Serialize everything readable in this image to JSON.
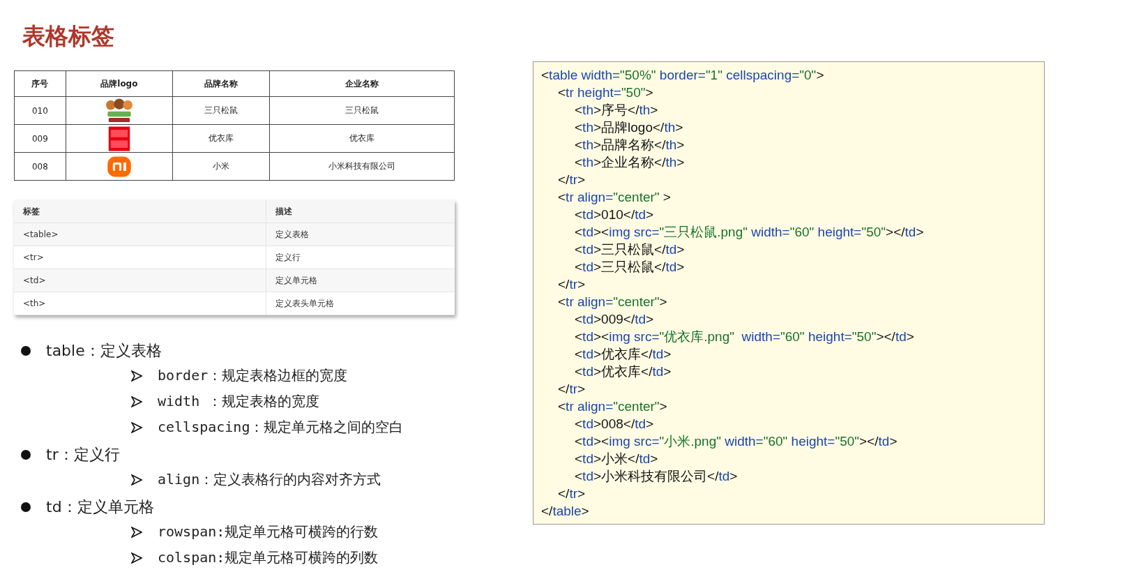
{
  "title": "表格标签",
  "brand_table": {
    "columns": [
      "序号",
      "品牌logo",
      "品牌名称",
      "企业名称"
    ],
    "rows": [
      {
        "number": "010",
        "brand": "三只松鼠",
        "company": "三只松鼠"
      },
      {
        "number": "009",
        "brand": "优衣库",
        "company": "优衣库"
      },
      {
        "number": "008",
        "brand": "小米",
        "company": "小米科技有限公司"
      }
    ]
  },
  "tag_table": {
    "columns": [
      "标签",
      "描述"
    ],
    "rows": [
      {
        "tag": "<table>",
        "description": "定义表格"
      },
      {
        "tag": "<tr>",
        "description": "定义行"
      },
      {
        "tag": "<td>",
        "description": "定义单元格"
      },
      {
        "tag": "<th>",
        "description": "定义表头单元格"
      }
    ]
  },
  "bullets": [
    {
      "text": "table：定义表格",
      "children": [
        {
          "text": "border：规定表格边框的宽度"
        },
        {
          "text": "width ：规定表格的宽度"
        },
        {
          "text": "cellspacing：规定单元格之间的空白"
        }
      ]
    },
    {
      "text": "tr：定义行",
      "children": [
        {
          "text": "align：定义表格行的内容对齐方式"
        }
      ]
    },
    {
      "text": "td：定义单元格",
      "children": [
        {
          "text": "rowspan:规定单元格可横跨的行数"
        },
        {
          "text": "colspan:规定单元格可横跨的列数"
        }
      ]
    }
  ],
  "code": {
    "open": [
      {
        "kind": "punct",
        "text": "<"
      },
      {
        "kind": "tag",
        "text": "table"
      },
      {
        "kind": "attr",
        "text": " width="
      },
      {
        "kind": "string",
        "text": "\"50%\""
      },
      {
        "kind": "attr",
        "text": " border="
      },
      {
        "kind": "string",
        "text": "\"1\""
      },
      {
        "kind": "attr",
        "text": " cellspacing="
      },
      {
        "kind": "string",
        "text": "\"0\""
      },
      {
        "kind": "punct",
        "text": ">"
      }
    ],
    "children": [
      {
        "open": [
          {
            "kind": "punct",
            "text": "<"
          },
          {
            "kind": "tag",
            "text": "tr"
          },
          {
            "kind": "attr",
            "text": " height="
          },
          {
            "kind": "string",
            "text": "\"50\""
          },
          {
            "kind": "punct",
            "text": ">"
          }
        ],
        "children": [
          {
            "line": [
              {
                "kind": "punct",
                "text": "<"
              },
              {
                "kind": "tag",
                "text": "th"
              },
              {
                "kind": "punct",
                "text": ">"
              },
              {
                "kind": "text",
                "text": "序号"
              },
              {
                "kind": "punct",
                "text": "</"
              },
              {
                "kind": "tag",
                "text": "th"
              },
              {
                "kind": "punct",
                "text": ">"
              }
            ]
          },
          {
            "line": [
              {
                "kind": "punct",
                "text": "<"
              },
              {
                "kind": "tag",
                "text": "th"
              },
              {
                "kind": "punct",
                "text": ">"
              },
              {
                "kind": "text",
                "text": "品牌logo"
              },
              {
                "kind": "punct",
                "text": "</"
              },
              {
                "kind": "tag",
                "text": "th"
              },
              {
                "kind": "punct",
                "text": ">"
              }
            ]
          },
          {
            "line": [
              {
                "kind": "punct",
                "text": "<"
              },
              {
                "kind": "tag",
                "text": "th"
              },
              {
                "kind": "punct",
                "text": ">"
              },
              {
                "kind": "text",
                "text": "品牌名称"
              },
              {
                "kind": "punct",
                "text": "</"
              },
              {
                "kind": "tag",
                "text": "th"
              },
              {
                "kind": "punct",
                "text": ">"
              }
            ]
          },
          {
            "line": [
              {
                "kind": "punct",
                "text": "<"
              },
              {
                "kind": "tag",
                "text": "th"
              },
              {
                "kind": "punct",
                "text": ">"
              },
              {
                "kind": "text",
                "text": "企业名称"
              },
              {
                "kind": "punct",
                "text": "</"
              },
              {
                "kind": "tag",
                "text": "th"
              },
              {
                "kind": "punct",
                "text": ">"
              }
            ]
          }
        ],
        "close": [
          {
            "kind": "punct",
            "text": "</"
          },
          {
            "kind": "tag",
            "text": "tr"
          },
          {
            "kind": "punct",
            "text": ">"
          }
        ]
      },
      {
        "open": [
          {
            "kind": "punct",
            "text": "<"
          },
          {
            "kind": "tag",
            "text": "tr"
          },
          {
            "kind": "attr",
            "text": " align="
          },
          {
            "kind": "string",
            "text": "\"center\""
          },
          {
            "kind": "punct",
            "text": " >"
          }
        ],
        "children": [
          {
            "line": [
              {
                "kind": "punct",
                "text": "<"
              },
              {
                "kind": "tag",
                "text": "td"
              },
              {
                "kind": "punct",
                "text": ">"
              },
              {
                "kind": "text",
                "text": "010"
              },
              {
                "kind": "punct",
                "text": "</"
              },
              {
                "kind": "tag",
                "text": "td"
              },
              {
                "kind": "punct",
                "text": ">"
              }
            ]
          },
          {
            "line": [
              {
                "kind": "punct",
                "text": "<"
              },
              {
                "kind": "tag",
                "text": "td"
              },
              {
                "kind": "punct",
                "text": "><"
              },
              {
                "kind": "tag",
                "text": "img"
              },
              {
                "kind": "attr",
                "text": " src="
              },
              {
                "kind": "string",
                "text": "\"三只松鼠.png\""
              },
              {
                "kind": "attr",
                "text": " width="
              },
              {
                "kind": "string",
                "text": "\"60\""
              },
              {
                "kind": "attr",
                "text": " height="
              },
              {
                "kind": "string",
                "text": "\"50\""
              },
              {
                "kind": "punct",
                "text": "></"
              },
              {
                "kind": "tag",
                "text": "td"
              },
              {
                "kind": "punct",
                "text": ">"
              }
            ]
          },
          {
            "line": [
              {
                "kind": "punct",
                "text": "<"
              },
              {
                "kind": "tag",
                "text": "td"
              },
              {
                "kind": "punct",
                "text": ">"
              },
              {
                "kind": "text",
                "text": "三只松鼠"
              },
              {
                "kind": "punct",
                "text": "</"
              },
              {
                "kind": "tag",
                "text": "td"
              },
              {
                "kind": "punct",
                "text": ">"
              }
            ]
          },
          {
            "line": [
              {
                "kind": "punct",
                "text": "<"
              },
              {
                "kind": "tag",
                "text": "td"
              },
              {
                "kind": "punct",
                "text": ">"
              },
              {
                "kind": "text",
                "text": "三只松鼠"
              },
              {
                "kind": "punct",
                "text": "</"
              },
              {
                "kind": "tag",
                "text": "td"
              },
              {
                "kind": "punct",
                "text": ">"
              }
            ]
          }
        ],
        "close": [
          {
            "kind": "punct",
            "text": "</"
          },
          {
            "kind": "tag",
            "text": "tr"
          },
          {
            "kind": "punct",
            "text": ">"
          }
        ]
      },
      {
        "open": [
          {
            "kind": "punct",
            "text": "<"
          },
          {
            "kind": "tag",
            "text": "tr"
          },
          {
            "kind": "attr",
            "text": " align="
          },
          {
            "kind": "string",
            "text": "\"center\""
          },
          {
            "kind": "punct",
            "text": ">"
          }
        ],
        "children": [
          {
            "line": [
              {
                "kind": "punct",
                "text": "<"
              },
              {
                "kind": "tag",
                "text": "td"
              },
              {
                "kind": "punct",
                "text": ">"
              },
              {
                "kind": "text",
                "text": "009"
              },
              {
                "kind": "punct",
                "text": "</"
              },
              {
                "kind": "tag",
                "text": "td"
              },
              {
                "kind": "punct",
                "text": ">"
              }
            ]
          },
          {
            "line": [
              {
                "kind": "punct",
                "text": "<"
              },
              {
                "kind": "tag",
                "text": "td"
              },
              {
                "kind": "punct",
                "text": "><"
              },
              {
                "kind": "tag",
                "text": "img"
              },
              {
                "kind": "attr",
                "text": " src="
              },
              {
                "kind": "string",
                "text": "\"优衣库.png\""
              },
              {
                "kind": "attr",
                "text": "  width="
              },
              {
                "kind": "string",
                "text": "\"60\""
              },
              {
                "kind": "attr",
                "text": " height="
              },
              {
                "kind": "string",
                "text": "\"50\""
              },
              {
                "kind": "punct",
                "text": "></"
              },
              {
                "kind": "tag",
                "text": "td"
              },
              {
                "kind": "punct",
                "text": ">"
              }
            ]
          },
          {
            "line": [
              {
                "kind": "punct",
                "text": "<"
              },
              {
                "kind": "tag",
                "text": "td"
              },
              {
                "kind": "punct",
                "text": ">"
              },
              {
                "kind": "text",
                "text": "优衣库"
              },
              {
                "kind": "punct",
                "text": "</"
              },
              {
                "kind": "tag",
                "text": "td"
              },
              {
                "kind": "punct",
                "text": ">"
              }
            ]
          },
          {
            "line": [
              {
                "kind": "punct",
                "text": "<"
              },
              {
                "kind": "tag",
                "text": "td"
              },
              {
                "kind": "punct",
                "text": ">"
              },
              {
                "kind": "text",
                "text": "优衣库"
              },
              {
                "kind": "punct",
                "text": "</"
              },
              {
                "kind": "tag",
                "text": "td"
              },
              {
                "kind": "punct",
                "text": ">"
              }
            ]
          }
        ],
        "close": [
          {
            "kind": "punct",
            "text": "</"
          },
          {
            "kind": "tag",
            "text": "tr"
          },
          {
            "kind": "punct",
            "text": ">"
          }
        ]
      },
      {
        "open": [
          {
            "kind": "punct",
            "text": "<"
          },
          {
            "kind": "tag",
            "text": "tr"
          },
          {
            "kind": "attr",
            "text": " align="
          },
          {
            "kind": "string",
            "text": "\"center\""
          },
          {
            "kind": "punct",
            "text": ">"
          }
        ],
        "children": [
          {
            "line": [
              {
                "kind": "punct",
                "text": "<"
              },
              {
                "kind": "tag",
                "text": "td"
              },
              {
                "kind": "punct",
                "text": ">"
              },
              {
                "kind": "text",
                "text": "008"
              },
              {
                "kind": "punct",
                "text": "</"
              },
              {
                "kind": "tag",
                "text": "td"
              },
              {
                "kind": "punct",
                "text": ">"
              }
            ]
          },
          {
            "line": [
              {
                "kind": "punct",
                "text": "<"
              },
              {
                "kind": "tag",
                "text": "td"
              },
              {
                "kind": "punct",
                "text": "><"
              },
              {
                "kind": "tag",
                "text": "img"
              },
              {
                "kind": "attr",
                "text": " src="
              },
              {
                "kind": "string",
                "text": "\"小米.png\""
              },
              {
                "kind": "attr",
                "text": " width="
              },
              {
                "kind": "string",
                "text": "\"60\""
              },
              {
                "kind": "attr",
                "text": " height="
              },
              {
                "kind": "string",
                "text": "\"50\""
              },
              {
                "kind": "punct",
                "text": "></"
              },
              {
                "kind": "tag",
                "text": "td"
              },
              {
                "kind": "punct",
                "text": ">"
              }
            ]
          },
          {
            "line": [
              {
                "kind": "punct",
                "text": "<"
              },
              {
                "kind": "tag",
                "text": "td"
              },
              {
                "kind": "punct",
                "text": ">"
              },
              {
                "kind": "text",
                "text": "小米"
              },
              {
                "kind": "punct",
                "text": "</"
              },
              {
                "kind": "tag",
                "text": "td"
              },
              {
                "kind": "punct",
                "text": ">"
              }
            ]
          },
          {
            "line": [
              {
                "kind": "punct",
                "text": "<"
              },
              {
                "kind": "tag",
                "text": "td"
              },
              {
                "kind": "punct",
                "text": ">"
              },
              {
                "kind": "text",
                "text": "小米科技有限公司"
              },
              {
                "kind": "punct",
                "text": "</"
              },
              {
                "kind": "tag",
                "text": "td"
              },
              {
                "kind": "punct",
                "text": ">"
              }
            ]
          }
        ],
        "close": [
          {
            "kind": "punct",
            "text": "</"
          },
          {
            "kind": "tag",
            "text": "tr"
          },
          {
            "kind": "punct",
            "text": ">"
          }
        ]
      }
    ],
    "close": [
      {
        "kind": "punct",
        "text": "</"
      },
      {
        "kind": "tag",
        "text": "table"
      },
      {
        "kind": "punct",
        "text": ">"
      }
    ]
  }
}
